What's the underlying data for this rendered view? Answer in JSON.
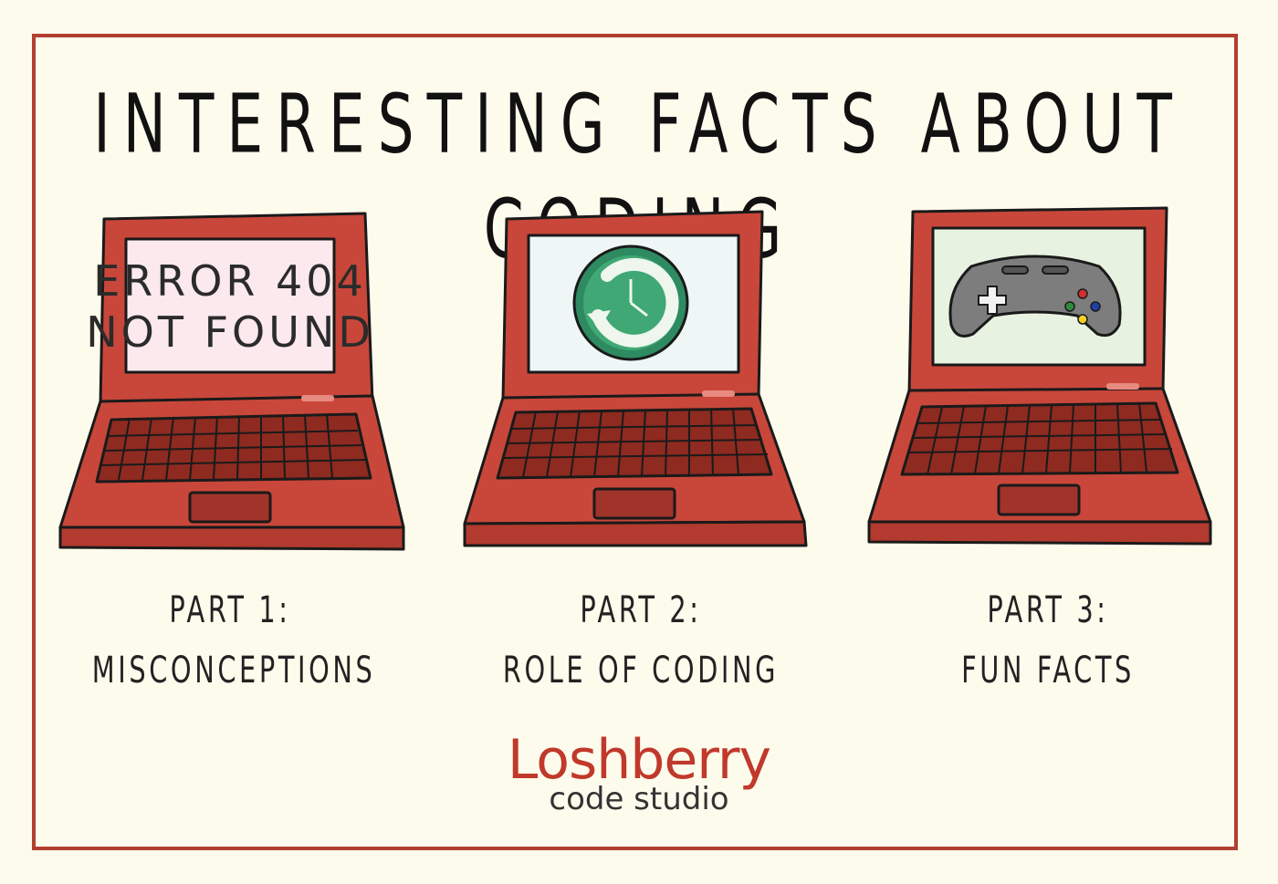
{
  "title": "INTERESTING FACTS ABOUT CODING",
  "laptops": [
    {
      "screen_lines": [
        "ERROR 404",
        "NOT FOUND"
      ],
      "screen_color": "#fbe9ee",
      "caption_line1": "PART 1:",
      "caption_line2": "MISCONCEPTIONS"
    },
    {
      "screen_icon": "time-machine-icon",
      "screen_color": "#eef6f6",
      "caption_line1": "PART 2:",
      "caption_line2": "ROLE OF CODING"
    },
    {
      "screen_icon": "game-controller-icon",
      "screen_color": "#e7f3e0",
      "caption_line1": "PART 3:",
      "caption_line2": "FUN FACTS"
    }
  ],
  "logo": {
    "name": "Loshberry",
    "subtitle": "code studio"
  },
  "colors": {
    "background": "#fdfbec",
    "frame": "#b23f31",
    "laptop_body": "#c8473a",
    "laptop_dark": "#8e2a20",
    "brand": "#c0392b"
  }
}
